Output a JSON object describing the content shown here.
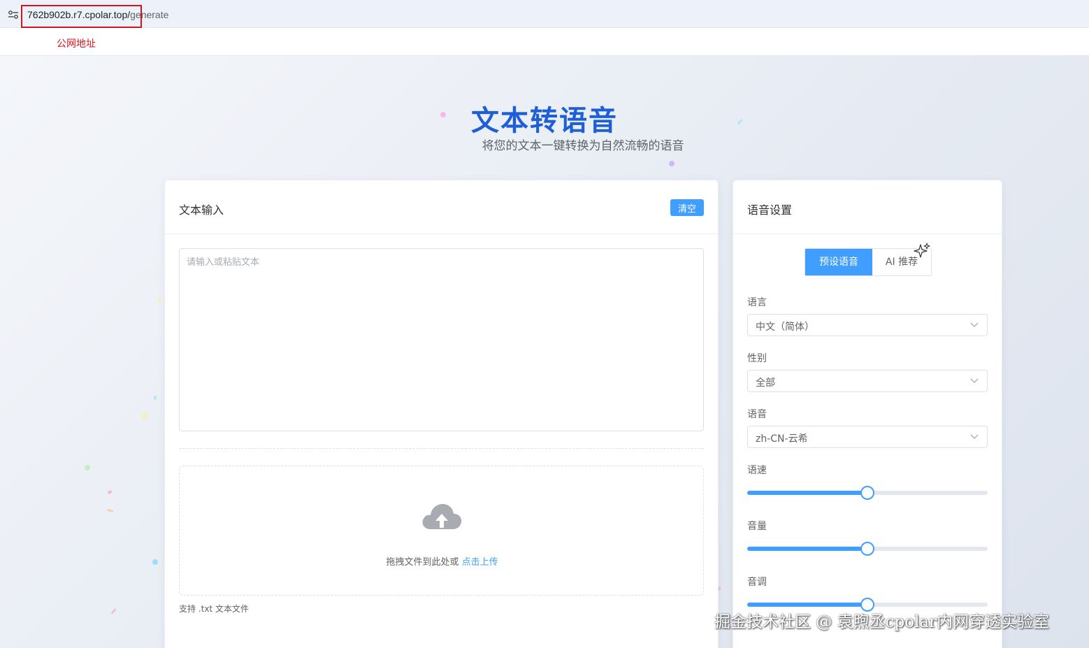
{
  "browser": {
    "url_host": "762b902b.r7.cpolar.top/",
    "url_path": "generate",
    "annotation": "公网地址",
    "annotation_color": "#d4161c"
  },
  "hero": {
    "title": "文本转语音",
    "subtitle": "将您的文本一键转换为自然流畅的语音"
  },
  "text_input": {
    "title": "文本输入",
    "clear_label": "清空",
    "placeholder": "请输入或粘贴文本",
    "value": "",
    "upload_text": "拖拽文件到此处或",
    "upload_link": "点击上传",
    "upload_tip": "支持 .txt 文本文件"
  },
  "voice_settings": {
    "title": "语音设置",
    "tabs": [
      {
        "label": "预设语音",
        "active": true
      },
      {
        "label": "AI 推荐",
        "active": false
      }
    ],
    "language": {
      "label": "语言",
      "value": "中文（简体）"
    },
    "gender": {
      "label": "性别",
      "value": "全部"
    },
    "voice": {
      "label": "语音",
      "value": "zh-CN-云希"
    },
    "rate": {
      "label": "语速",
      "level": 0.5
    },
    "volume": {
      "label": "音量",
      "level": 0.5
    },
    "pitch": {
      "label": "音调",
      "level": 0.5
    }
  },
  "watermark": "掘金技术社区 @ 袁煦丞cpolar内网穿透实验室",
  "colors": {
    "accent": "#409eff",
    "title": "#1f5fd6"
  }
}
